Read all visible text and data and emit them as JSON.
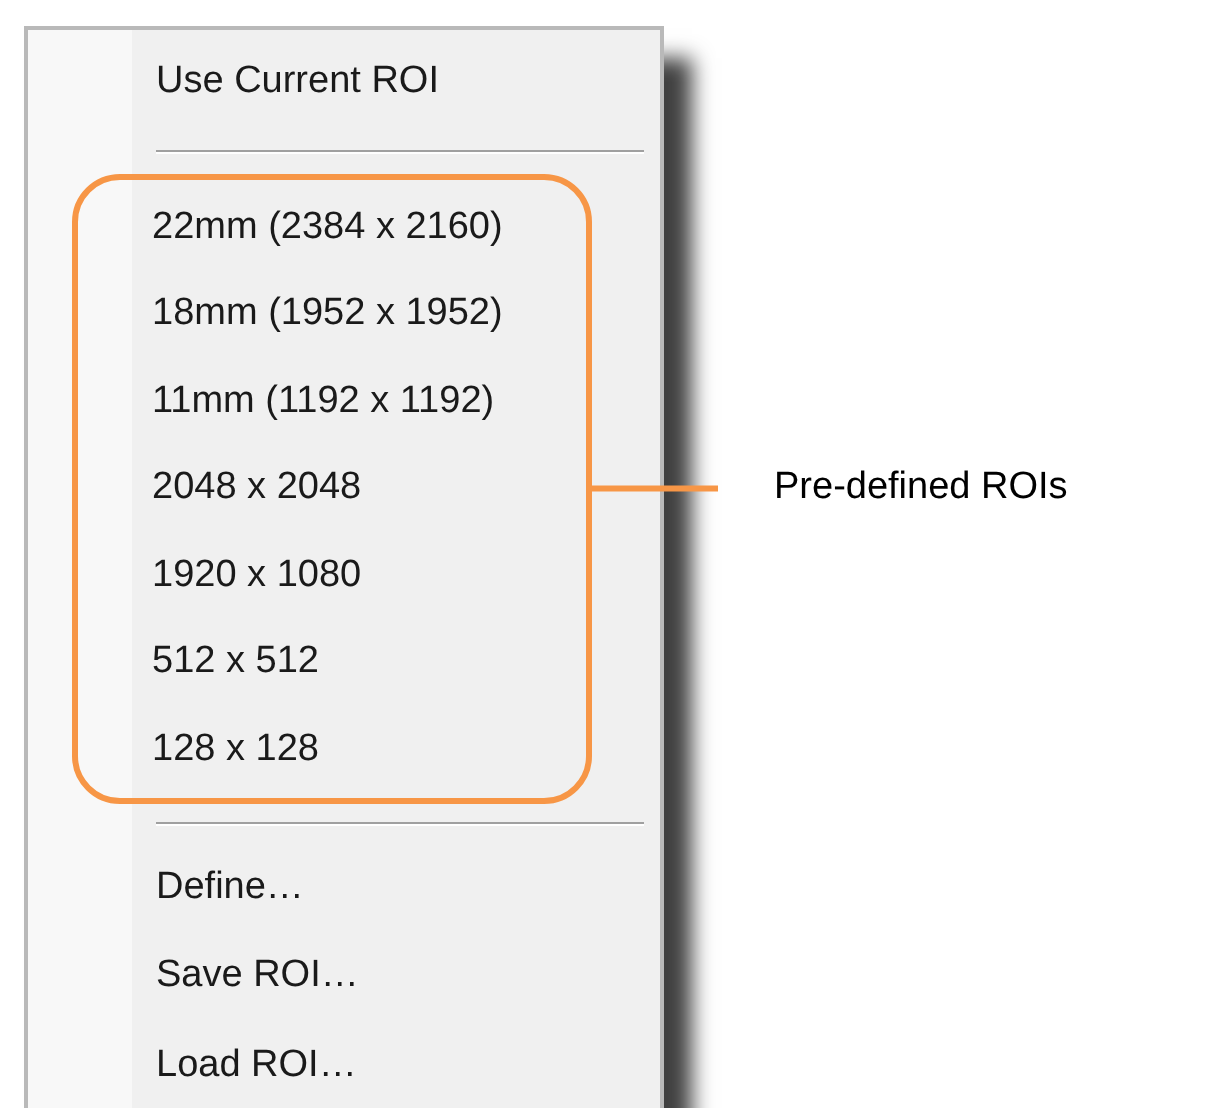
{
  "menu": {
    "top_items": [
      "Use Current ROI"
    ],
    "preset_items": [
      "22mm (2384 x 2160)",
      "18mm (1952 x 1952)",
      "11mm (1192 x 1192)",
      "2048 x 2048",
      "1920 x 1080",
      "512 x 512",
      "128 x 128"
    ],
    "bottom_items": [
      "Define…",
      "Save ROI…",
      "Load ROI…"
    ]
  },
  "callout": {
    "label": "Pre-defined ROIs"
  }
}
